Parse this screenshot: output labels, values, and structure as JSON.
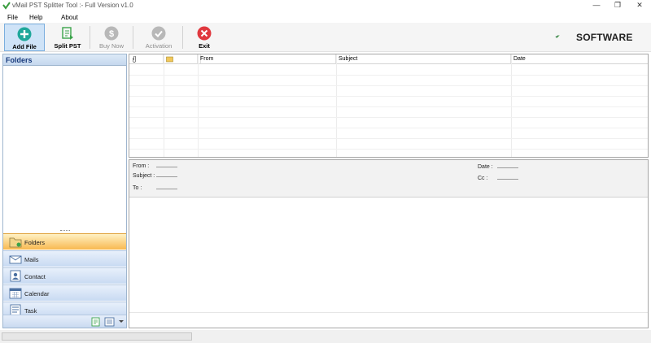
{
  "window": {
    "title": "vMail PST Splitter Tool :- Full Version v1.0",
    "minimize_glyph": "—",
    "maximize_glyph": "❐",
    "close_glyph": "✕"
  },
  "menu": {
    "items": [
      {
        "label": "File"
      },
      {
        "label": "Help"
      },
      {
        "label": "About"
      }
    ]
  },
  "toolbar": {
    "buttons": [
      {
        "label": "Add File",
        "icon": "plus-circle-icon",
        "color": "#1fa79a",
        "state": "active"
      },
      {
        "label": "Split PST",
        "icon": "split-icon",
        "color": "#3aa34a",
        "state": "enabled"
      },
      {
        "label": "Buy Now",
        "icon": "dollar-icon",
        "color": "#b8b8b8",
        "state": "disabled"
      },
      {
        "label": "Activation",
        "icon": "check-circle-icon",
        "color": "#b8b8b8",
        "state": "disabled"
      },
      {
        "label": "Exit",
        "icon": "close-circle-icon",
        "color": "#e0383e",
        "state": "enabled"
      }
    ]
  },
  "brand": {
    "text": "SOFTWARE",
    "colors": [
      "#1e6b3a",
      "#59b04a"
    ]
  },
  "left_panel": {
    "title": "Folders",
    "nav": [
      {
        "label": "Folders",
        "icon": "folder-icon",
        "active": true
      },
      {
        "label": "Mails",
        "icon": "mail-icon",
        "active": false
      },
      {
        "label": "Contact",
        "icon": "contact-icon",
        "active": false
      },
      {
        "label": "Calendar",
        "icon": "calendar-icon",
        "active": false
      },
      {
        "label": "Task",
        "icon": "task-icon",
        "active": false
      }
    ]
  },
  "grid": {
    "columns": [
      {
        "label": "",
        "icon": "attachment-icon"
      },
      {
        "label": "",
        "icon": "envelope-icon"
      },
      {
        "label": ""
      },
      {
        "label": "From"
      },
      {
        "label": "Subject"
      },
      {
        "label": "Date"
      }
    ],
    "rows": []
  },
  "preview": {
    "from_label": "From :",
    "subject_label": "Subject :",
    "to_label": "To :",
    "date_label": "Date :",
    "cc_label": "Cc :",
    "from_value": "",
    "subject_value": "",
    "to_value": "",
    "date_value": "",
    "cc_value": ""
  },
  "colors": {
    "accent": "#7aaede",
    "nav_active": "#f8b850",
    "header_title": "#16387b"
  }
}
